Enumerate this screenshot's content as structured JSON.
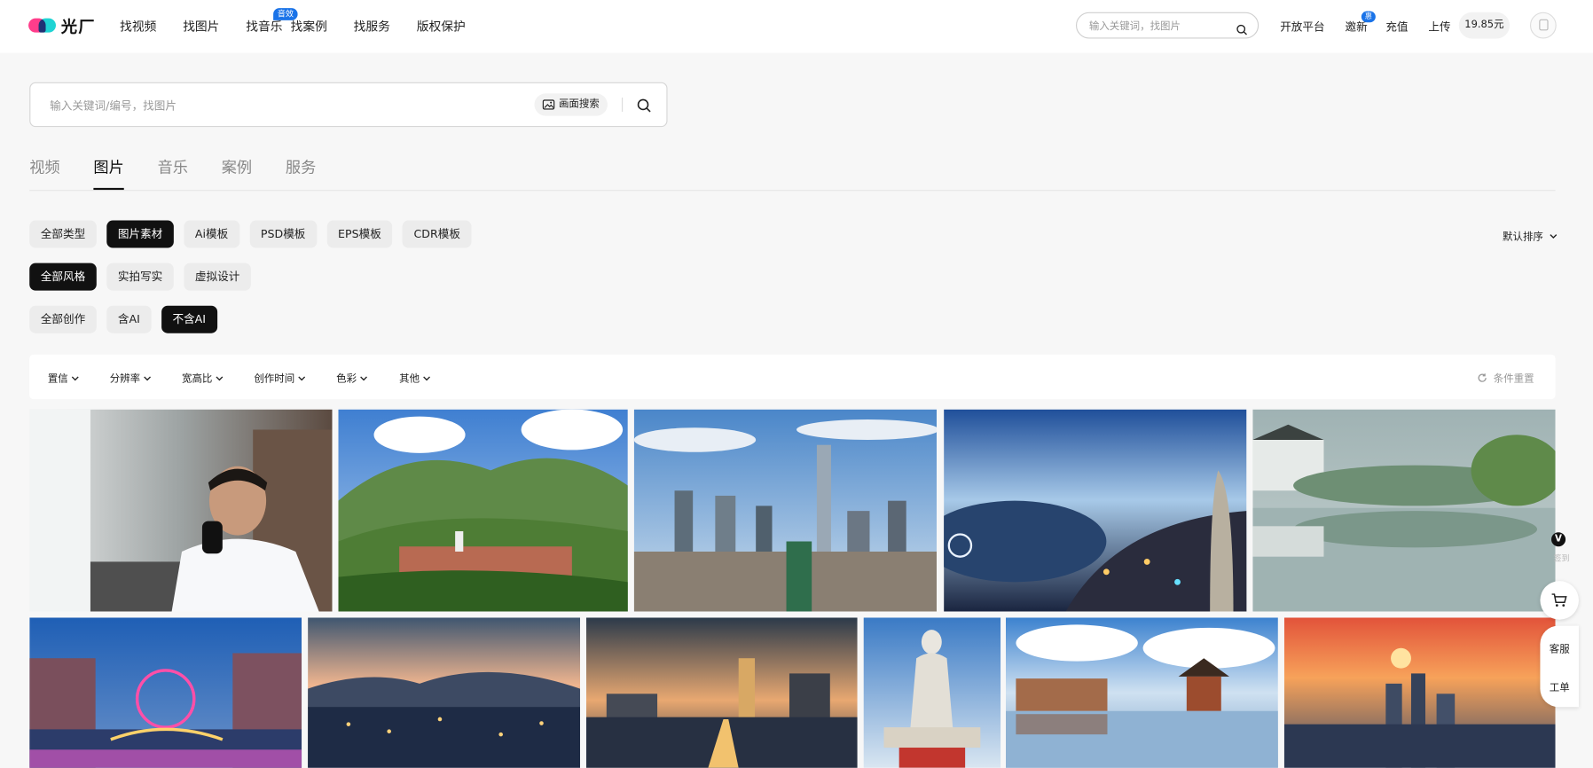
{
  "header": {
    "logo_text": "光厂",
    "nav": [
      {
        "label": "找视频"
      },
      {
        "label": "找图片"
      },
      {
        "label": "找音乐",
        "badge": "音效"
      },
      {
        "label": "找案例"
      },
      {
        "label": "找服务"
      },
      {
        "label": "版权保护"
      }
    ],
    "search_placeholder": "输入关键词，找图片",
    "links": [
      {
        "label": "开放平台"
      },
      {
        "label": "邀新",
        "badge": "惠"
      },
      {
        "label": "充值"
      },
      {
        "label": "上传"
      }
    ],
    "balance": "19.85元"
  },
  "search": {
    "placeholder": "输入关键词/编号，找图片",
    "image_search_label": "画面搜索"
  },
  "tabs": [
    {
      "label": "视频",
      "active": false
    },
    {
      "label": "图片",
      "active": true
    },
    {
      "label": "音乐",
      "active": false
    },
    {
      "label": "案例",
      "active": false
    },
    {
      "label": "服务",
      "active": false
    }
  ],
  "filters": {
    "type": [
      {
        "label": "全部类型",
        "active": false
      },
      {
        "label": "图片素材",
        "active": true
      },
      {
        "label": "Ai模板",
        "active": false
      },
      {
        "label": "PSD模板",
        "active": false
      },
      {
        "label": "EPS模板",
        "active": false
      },
      {
        "label": "CDR模板",
        "active": false
      }
    ],
    "style": [
      {
        "label": "全部风格",
        "active": true
      },
      {
        "label": "实拍写实",
        "active": false
      },
      {
        "label": "虚拟设计",
        "active": false
      }
    ],
    "creation": [
      {
        "label": "全部创作",
        "active": false
      },
      {
        "label": "含AI",
        "active": false
      },
      {
        "label": "不含AI",
        "active": true
      }
    ],
    "sort_label": "默认排序",
    "dropdowns": [
      {
        "label": "置信"
      },
      {
        "label": "分辨率"
      },
      {
        "label": "宽高比"
      },
      {
        "label": "创作时间"
      },
      {
        "label": "色彩"
      },
      {
        "label": "其他"
      }
    ],
    "reset_label": "条件重置"
  },
  "images": [
    {
      "name": "businessman-phone-photo"
    },
    {
      "name": "mountain-temple-photo"
    },
    {
      "name": "city-skyline-photo"
    },
    {
      "name": "night-waterfront-photo"
    },
    {
      "name": "misty-lake-village-photo"
    },
    {
      "name": "ferris-wheel-night-photo"
    },
    {
      "name": "harbor-dusk-photo"
    },
    {
      "name": "bridge-sunset-city-photo"
    },
    {
      "name": "statue-photo"
    },
    {
      "name": "pavilion-reflection-photo"
    },
    {
      "name": "sunset-skyline-photo"
    }
  ],
  "side_tools": {
    "v_label": "V",
    "v_caption": "签到",
    "service_label": "客服",
    "ticket_label": "工单"
  },
  "colors": {
    "accent": "#1a73e8",
    "active_chip": "#111111",
    "page_bg": "#f7f7f7"
  }
}
